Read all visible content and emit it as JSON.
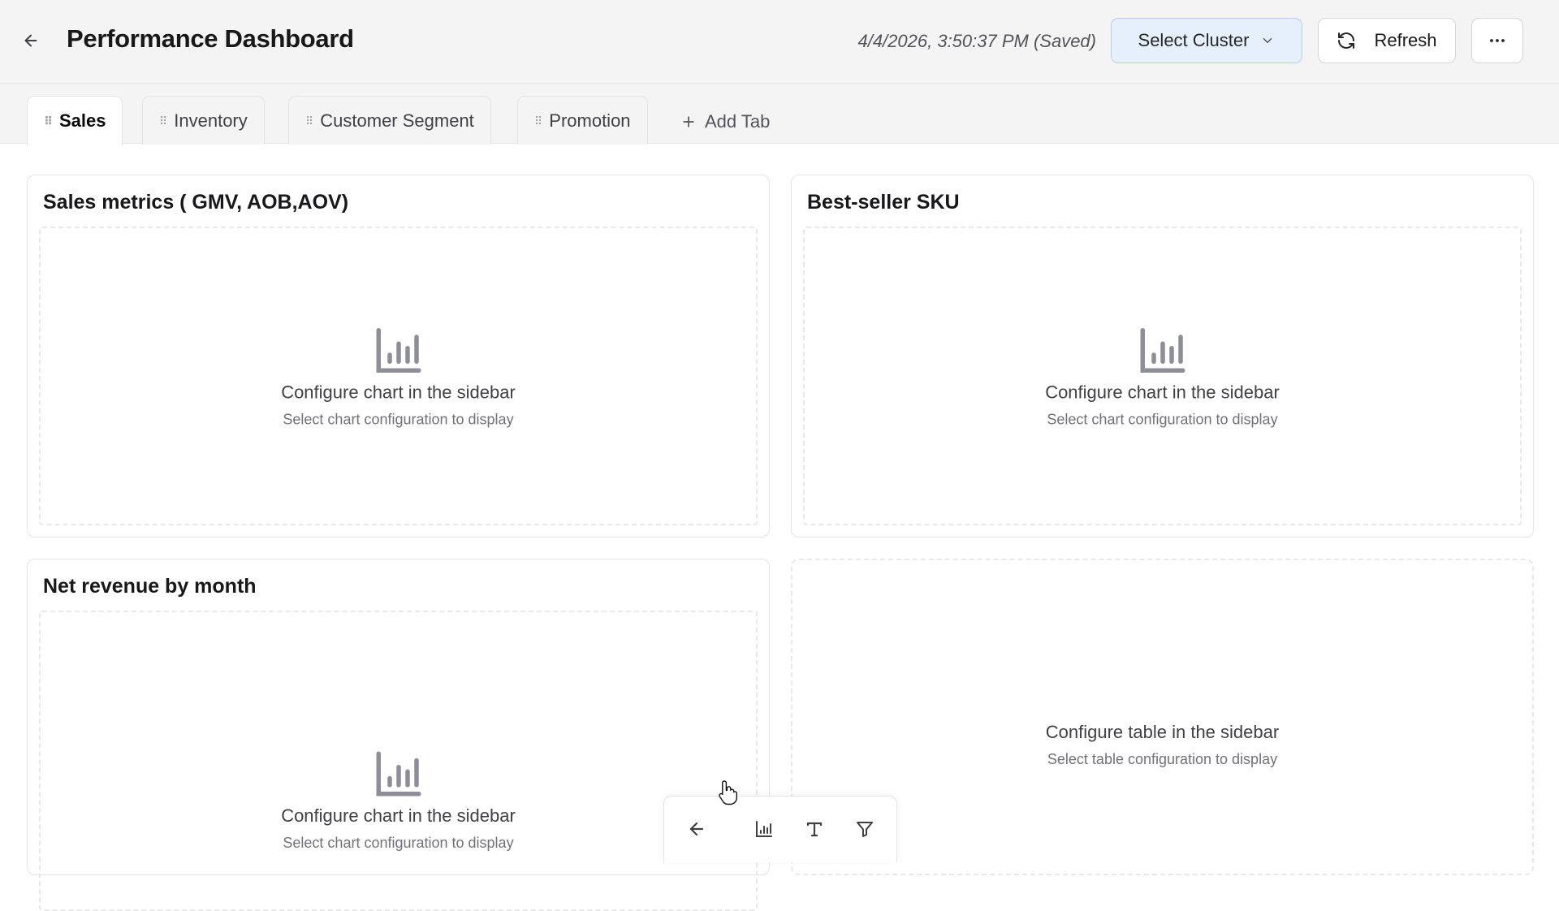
{
  "header": {
    "title": "Performance Dashboard",
    "saved_status": "4/4/2026, 3:50:37 PM (Saved)",
    "cluster_label": "Select Cluster",
    "refresh_label": "Refresh",
    "icons": {
      "back": "arrow-left-icon",
      "cluster": "chevron-down-icon",
      "refresh": "refresh-icon",
      "more": "more-horizontal-icon"
    }
  },
  "tabs": [
    {
      "label": "Sales",
      "active": true
    },
    {
      "label": "Inventory",
      "active": false
    },
    {
      "label": "Customer Segment",
      "active": false
    },
    {
      "label": "Promotion",
      "active": false
    }
  ],
  "add_tab_label": "Add Tab",
  "widgets": [
    {
      "title": "Sales metrics ( GMV, AOB,AOV)",
      "message": "Configure chart in the sidebar",
      "hint": "Select chart configuration to display",
      "kind": "chart"
    },
    {
      "title": "Best-seller SKU",
      "message": "Configure chart in the sidebar",
      "hint": "Select chart configuration to display",
      "kind": "chart"
    },
    {
      "title": "Net revenue by month",
      "message": "Configure chart in the sidebar",
      "hint": "Select chart configuration to display",
      "kind": "chart"
    },
    {
      "title": "",
      "message": "Configure table in the sidebar",
      "hint": "Select table configuration to display",
      "kind": "table"
    }
  ],
  "toolbar": {
    "tools": [
      "arrow-left-icon",
      "bar-chart-icon",
      "text-icon",
      "filter-icon"
    ]
  },
  "colors": {
    "accent": "#e6effc",
    "accent_border": "#b7cdf1",
    "header_bg": "#f4f4f5",
    "icon_gray": "#8e8e98"
  }
}
